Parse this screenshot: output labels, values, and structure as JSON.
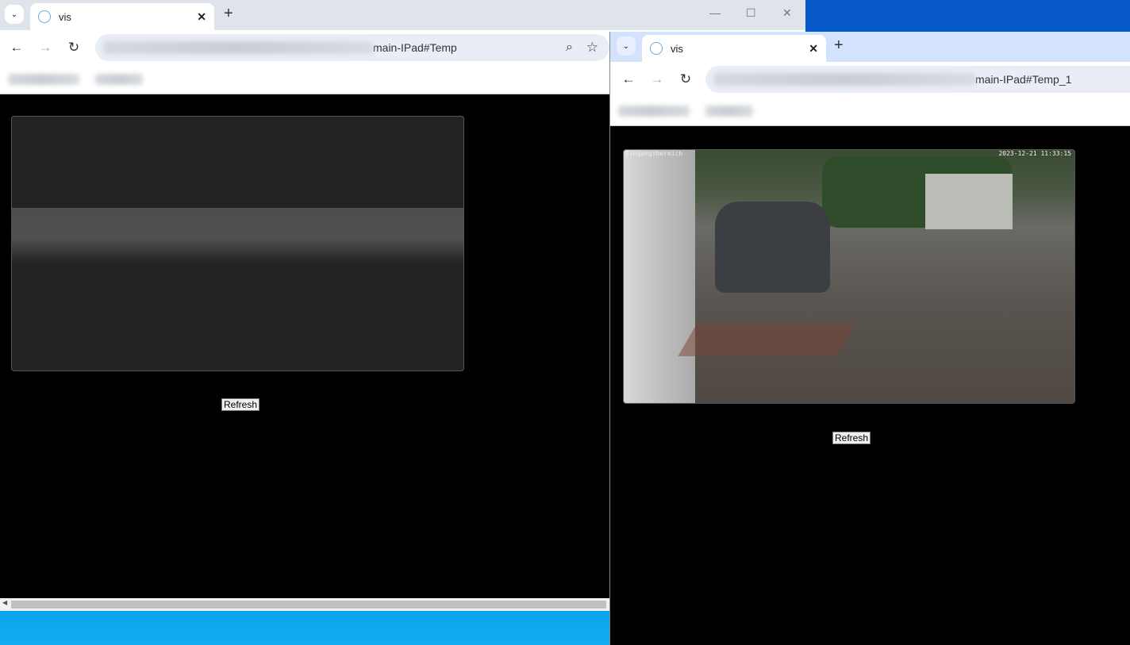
{
  "left_window": {
    "tab_title": "vis",
    "url_visible": "main-IPad#Temp",
    "refresh_label": "Refresh"
  },
  "right_window": {
    "tab_title": "vis",
    "url_visible": "main-IPad#Temp_1",
    "refresh_label": "Refresh",
    "camera": {
      "label": "Eingangsbereich",
      "timestamp": "2023-12-21 11:33:15"
    }
  }
}
